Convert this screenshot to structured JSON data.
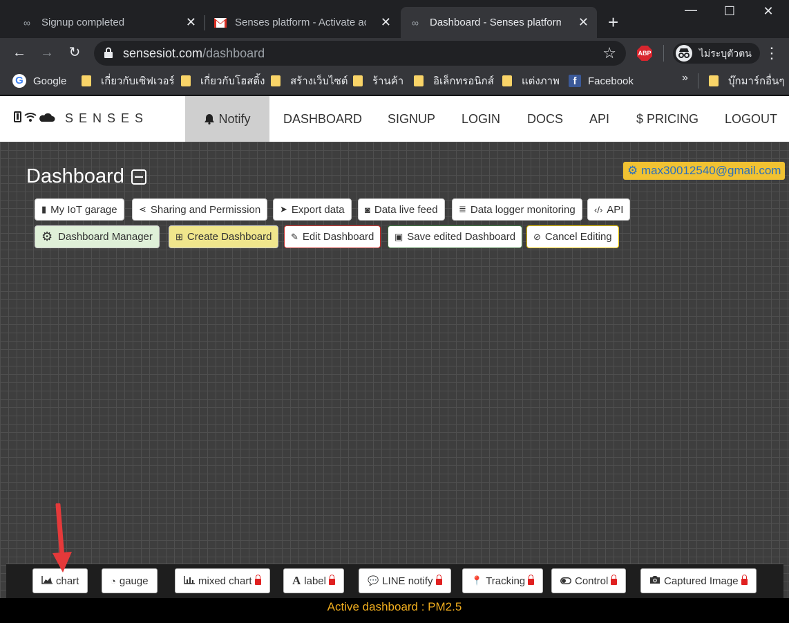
{
  "browser": {
    "tabs": [
      {
        "title": "Signup completed",
        "favicon": "infinity-icon",
        "active": false
      },
      {
        "title": "Senses platform - Activate acco",
        "favicon": "gmail-icon",
        "active": false
      },
      {
        "title": "Dashboard - Senses platform |",
        "favicon": "infinity-icon",
        "active": true
      }
    ],
    "url_host": "sensesiot.com",
    "url_path": "/dashboard",
    "abp_label": "ABP",
    "incognito_label": "ไม่ระบุตัวตน",
    "bookmarks": [
      {
        "label": "Google",
        "icon": "google-icon"
      },
      {
        "label": "เกี่ยวกับเซิฟเวอร์",
        "icon": "folder-icon"
      },
      {
        "label": "เกี่ยวกับโฮสติ้ง",
        "icon": "folder-icon"
      },
      {
        "label": "สร้างเว็บไซต์",
        "icon": "folder-icon"
      },
      {
        "label": "ร้านค้า",
        "icon": "folder-icon"
      },
      {
        "label": "อิเล็กทรอนิกส์",
        "icon": "folder-icon"
      },
      {
        "label": "แต่งภาพ",
        "icon": "folder-icon"
      },
      {
        "label": "Facebook",
        "icon": "facebook-icon"
      }
    ],
    "bookmarks_more": "»",
    "other_bookmarks": "บุ๊กมาร์กอื่นๆ"
  },
  "site": {
    "brand": "SENSES",
    "nav": [
      {
        "label": "Notify",
        "icon": "bell-icon",
        "active": true
      },
      {
        "label": "DASHBOARD"
      },
      {
        "label": "SIGNUP"
      },
      {
        "label": "LOGIN"
      },
      {
        "label": "DOCS"
      },
      {
        "label": "API"
      },
      {
        "label": "PRICING",
        "icon": "dollar-icon"
      },
      {
        "label": "LOGOUT"
      }
    ]
  },
  "dashboard": {
    "title": "Dashboard",
    "user_email": "max30012540@gmail.com",
    "toolbar_row1": [
      {
        "label": "My IoT garage",
        "icon": "mobile-icon"
      },
      {
        "label": "Sharing and Permission",
        "icon": "share-icon"
      },
      {
        "label": "Export data",
        "icon": "paper-plane-icon"
      },
      {
        "label": "Data live feed",
        "icon": "rss-icon"
      },
      {
        "label": "Data logger monitoring",
        "icon": "database-icon"
      },
      {
        "label": "API",
        "icon": "code-icon"
      }
    ],
    "toolbar_row2": [
      {
        "label": "Dashboard Manager",
        "icon": "gear-icon"
      },
      {
        "label": "Create Dashboard",
        "icon": "plus-square-icon"
      },
      {
        "label": "Edit Dashboard",
        "icon": "edit-icon"
      },
      {
        "label": "Save edited Dashboard",
        "icon": "save-icon"
      },
      {
        "label": "Cancel Editing",
        "icon": "ban-icon"
      }
    ]
  },
  "widgets": [
    {
      "label": "chart",
      "icon": "area-chart-icon",
      "locked": false
    },
    {
      "label": "gauge",
      "icon": "gauge-icon",
      "locked": false
    },
    {
      "label": "mixed chart",
      "icon": "bar-chart-icon",
      "locked": true
    },
    {
      "label": "label",
      "icon": "font-icon",
      "locked": true
    },
    {
      "label": "LINE notify",
      "icon": "comment-icon",
      "locked": true
    },
    {
      "label": "Tracking",
      "icon": "map-marker-icon",
      "locked": true
    },
    {
      "label": "Control",
      "icon": "toggle-icon",
      "locked": true
    },
    {
      "label": "Captured Image",
      "icon": "camera-icon",
      "locked": true
    }
  ],
  "status": "Active dashboard : PM2.5",
  "colors": {
    "accent_badge": "#f1c232",
    "status_text": "#f0ad1e",
    "annotation_arrow": "#e5393a"
  }
}
